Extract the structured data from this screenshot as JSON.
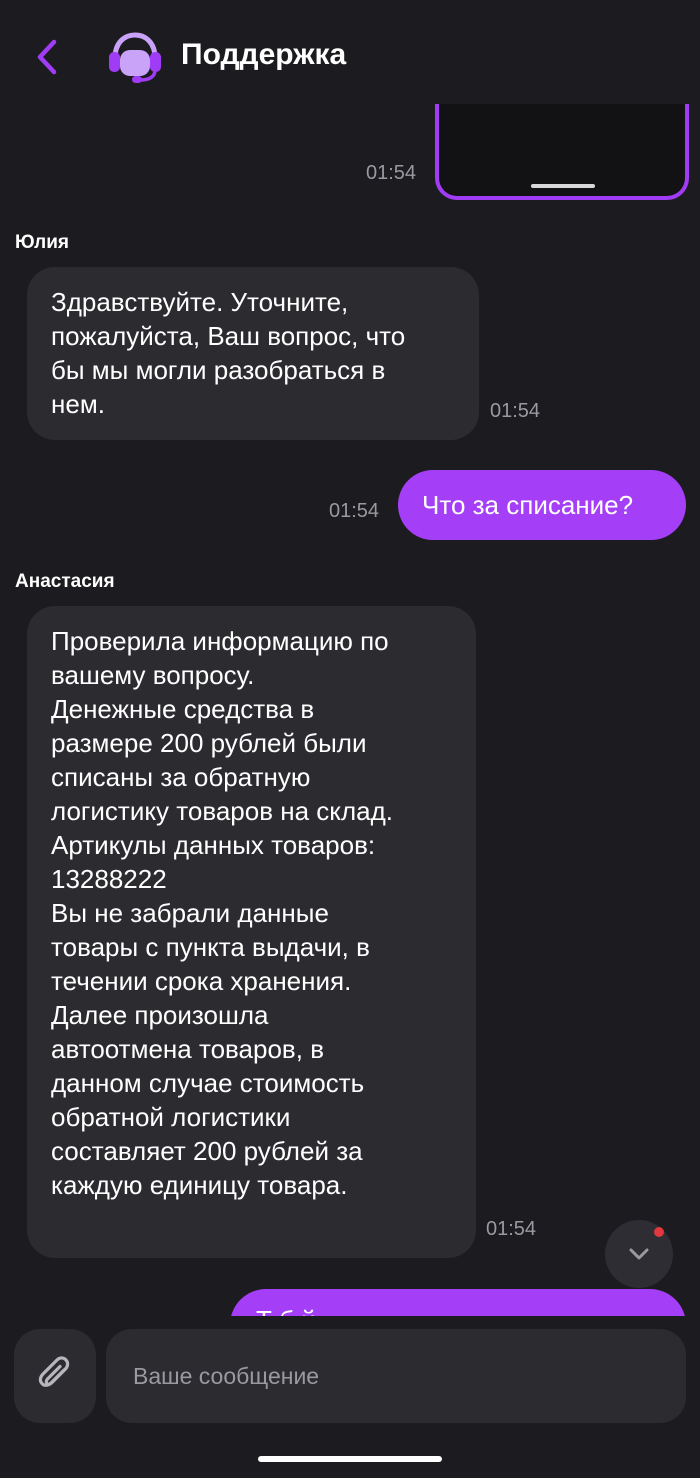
{
  "header": {
    "title": "Поддержка",
    "back_icon": "chevron-left-icon",
    "avatar_icon": "headset-icon",
    "accent": "#a03cf5"
  },
  "messages": [
    {
      "type": "outgoing-media",
      "time": "01:54"
    },
    {
      "type": "incoming",
      "sender": "Юлия",
      "text": "Здравствуйте. Уточните,\nпожалуйста, Ваш вопрос, что\nбы мы могли разобраться в\nнем.",
      "time": "01:54"
    },
    {
      "type": "outgoing",
      "text": "Что за списание?",
      "time": "01:54"
    },
    {
      "type": "incoming",
      "sender": "Анастасия",
      "text": "Проверила информацию по\nвашему вопросу.\nДенежные средства в\nразмере 200 рублей были\nсписаны за обратную\nлогистику товаров на склад.\nАртикулы данных товаров:\n13288222\nВы не забрали данные\nтовары с пункта выдачи, в\nтечении срока хранения.\nДалее произошла\nавтоотмена товаров, в\nданном случае стоимость\nобратной логистики\nсоставляет 200 рублей за\nкаждую единицу товара.",
      "time": "01:54"
    },
    {
      "type": "outgoing-partial",
      "text": "Т          б                                         й"
    }
  ],
  "scroll_button": {
    "icon": "chevron-down-icon",
    "has_unread": true
  },
  "composer": {
    "placeholder": "Ваше сообщение",
    "attach_icon": "paperclip-icon"
  },
  "colors": {
    "background": "#1c1b1f",
    "incoming_bubble": "#2c2b30",
    "outgoing_bubble": "#a53ff7",
    "timestamp": "#9a99a0",
    "unread_dot": "#e0383e"
  }
}
